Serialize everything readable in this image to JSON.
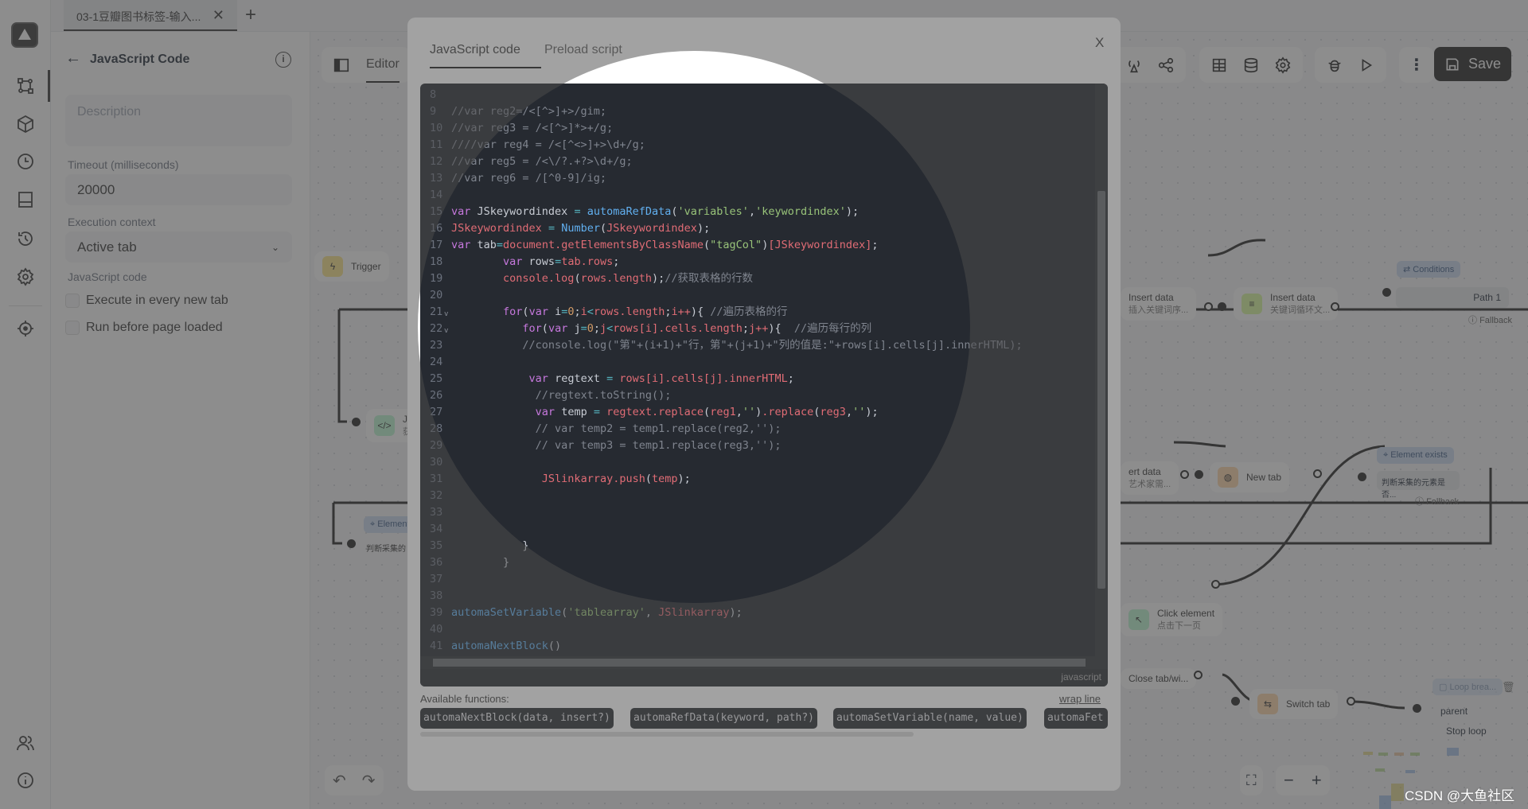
{
  "window_tab": {
    "title": "03-1豆瓣图书标签-输入...",
    "close": "✕",
    "add": "+"
  },
  "rail": {
    "icons": [
      "workflow-icon",
      "package-icon",
      "schedule-icon",
      "storage-icon",
      "history-icon",
      "settings-icon",
      "crosshair-icon",
      "community-icon",
      "about-icon"
    ]
  },
  "panel": {
    "back": "←",
    "title": "JavaScript Code",
    "description_placeholder": "Description",
    "timeout_label": "Timeout (milliseconds)",
    "timeout_value": "20000",
    "context_label": "Execution context",
    "context_value": "Active tab",
    "code_label": "JavaScript code",
    "checkbox_new_tab": "Execute in every new tab",
    "checkbox_before_load": "Run before page loaded"
  },
  "canvas": {
    "editor_tab": "Editor",
    "save_label": "Save",
    "nodes": {
      "trigger": "Trigger",
      "insert1_title": "Insert data",
      "insert1_sub": "插入关键词序...",
      "insert2_title": "Insert data",
      "insert2_sub": "关键词循环文...",
      "conditions": "Conditions",
      "path1": "Path 1",
      "fallback": "Fallback",
      "js_title": "Jav",
      "js_sub": "获取",
      "element_exists": "Element exists",
      "element_short": "Element",
      "element_desc": "判断采集的元素是否...",
      "element_desc_short": "判断采集的",
      "insert3_title": "ert data",
      "insert3_sub": "艺术家需...",
      "newtab": "New tab",
      "click_title": "Click element",
      "click_sub": "点击下一页",
      "closetab": "Close tab/wi...",
      "switchtab": "Switch tab",
      "loopbreak": "Loop brea...",
      "parent": "parent",
      "stoploop": "Stop loop"
    }
  },
  "modal": {
    "tabs": [
      {
        "label": "JavaScript code",
        "active": true
      },
      {
        "label": "Preload script",
        "active": false
      }
    ],
    "close": "X",
    "language": "javascript",
    "available_label": "Available functions:",
    "wrap_label": "wrap line",
    "functions": [
      "automaNextBlock(data, insert?)",
      "automaRefData(keyword, path?)",
      "automaSetVariable(name, value)",
      "automaFet"
    ],
    "code_lines": [
      {
        "n": "8",
        "t": []
      },
      {
        "n": "9",
        "t": [
          [
            "c",
            "//var reg2=/<[^>]+>/gim;"
          ]
        ]
      },
      {
        "n": "10",
        "t": [
          [
            "c",
            "//var reg3 = /<[^>]*>+/g;"
          ]
        ]
      },
      {
        "n": "11",
        "t": [
          [
            "c",
            "////var reg4 = /<[^<>]+>\\d+/g;"
          ]
        ]
      },
      {
        "n": "12",
        "t": [
          [
            "c",
            "//var reg5 = /<\\/?.+?>\\d+/g;"
          ]
        ]
      },
      {
        "n": "13",
        "t": [
          [
            "c",
            "//var reg6 = /[^0-9]/ig;"
          ]
        ]
      },
      {
        "n": "14",
        "t": []
      },
      {
        "n": "15",
        "t": [
          [
            "k",
            "var"
          ],
          [
            "p",
            " JSkeywordindex "
          ],
          [
            "o",
            "="
          ],
          [
            "p",
            " "
          ],
          [
            "f",
            "automaRefData"
          ],
          [
            "p",
            "("
          ],
          [
            "s",
            "'variables'"
          ],
          [
            "p",
            ","
          ],
          [
            "s",
            "'keywordindex'"
          ],
          [
            "p",
            ");"
          ]
        ]
      },
      {
        "n": "16",
        "t": [
          [
            "v",
            "JSkeywordindex"
          ],
          [
            "p",
            " "
          ],
          [
            "o",
            "="
          ],
          [
            "p",
            " "
          ],
          [
            "f",
            "Number"
          ],
          [
            "p",
            "("
          ],
          [
            "v",
            "JSkeywordindex"
          ],
          [
            "p",
            ");"
          ]
        ]
      },
      {
        "n": "17",
        "t": [
          [
            "k",
            "var"
          ],
          [
            "p",
            " tab"
          ],
          [
            "o",
            "="
          ],
          [
            "v",
            "document.getElementsByClassName"
          ],
          [
            "p",
            "("
          ],
          [
            "s",
            "\"tagCol\""
          ],
          [
            "p",
            ")"
          ],
          [
            "v",
            "[JSkeywordindex]"
          ],
          [
            "p",
            ";"
          ]
        ]
      },
      {
        "n": "18",
        "t": [
          [
            "p",
            "        "
          ],
          [
            "k",
            "var"
          ],
          [
            "p",
            " rows"
          ],
          [
            "o",
            "="
          ],
          [
            "v",
            "tab.rows"
          ],
          [
            "p",
            ";"
          ]
        ]
      },
      {
        "n": "19",
        "t": [
          [
            "p",
            "        "
          ],
          [
            "v",
            "console.log"
          ],
          [
            "p",
            "("
          ],
          [
            "v",
            "rows.length"
          ],
          [
            "p",
            ");"
          ],
          [
            "c",
            "//获取表格的行数"
          ]
        ]
      },
      {
        "n": "20",
        "t": []
      },
      {
        "n": "21",
        "fold": true,
        "t": [
          [
            "p",
            "        "
          ],
          [
            "k",
            "for"
          ],
          [
            "p",
            "("
          ],
          [
            "k",
            "var"
          ],
          [
            "p",
            " i"
          ],
          [
            "o",
            "="
          ],
          [
            "n",
            "0"
          ],
          [
            "p",
            ";"
          ],
          [
            "v",
            "i"
          ],
          [
            "o",
            "<"
          ],
          [
            "v",
            "rows.length"
          ],
          [
            "p",
            ";"
          ],
          [
            "v",
            "i++"
          ],
          [
            "p",
            "){ "
          ],
          [
            "c",
            "//遍历表格的行"
          ]
        ]
      },
      {
        "n": "22",
        "fold": true,
        "t": [
          [
            "p",
            "           "
          ],
          [
            "k",
            "for"
          ],
          [
            "p",
            "("
          ],
          [
            "k",
            "var"
          ],
          [
            "p",
            " j"
          ],
          [
            "o",
            "="
          ],
          [
            "n",
            "0"
          ],
          [
            "p",
            ";"
          ],
          [
            "v",
            "j"
          ],
          [
            "o",
            "<"
          ],
          [
            "v",
            "rows[i].cells.length"
          ],
          [
            "p",
            ";"
          ],
          [
            "v",
            "j++"
          ],
          [
            "p",
            "){  "
          ],
          [
            "c",
            "//遍历每行的列"
          ]
        ]
      },
      {
        "n": "23",
        "t": [
          [
            "p",
            "           "
          ],
          [
            "c",
            "//console.log(\"第\"+(i+1)+\"行，第\"+(j+1)+\"列的值是:\"+rows[i].cells[j].innerHTML);"
          ]
        ]
      },
      {
        "n": "24",
        "t": []
      },
      {
        "n": "25",
        "t": [
          [
            "p",
            "            "
          ],
          [
            "k",
            "var"
          ],
          [
            "p",
            " regtext "
          ],
          [
            "o",
            "="
          ],
          [
            "p",
            " "
          ],
          [
            "v",
            "rows[i].cells[j].innerHTML"
          ],
          [
            "p",
            ";"
          ]
        ]
      },
      {
        "n": "26",
        "t": [
          [
            "p",
            "             "
          ],
          [
            "c",
            "//regtext.toString();"
          ]
        ]
      },
      {
        "n": "27",
        "t": [
          [
            "p",
            "             "
          ],
          [
            "k",
            "var"
          ],
          [
            "p",
            " temp "
          ],
          [
            "o",
            "="
          ],
          [
            "p",
            " "
          ],
          [
            "v",
            "regtext.replace"
          ],
          [
            "p",
            "("
          ],
          [
            "v",
            "reg1"
          ],
          [
            "p",
            ","
          ],
          [
            "s",
            "''"
          ],
          [
            "p",
            ")"
          ],
          [
            "v",
            ".replace"
          ],
          [
            "p",
            "("
          ],
          [
            "v",
            "reg3"
          ],
          [
            "p",
            ","
          ],
          [
            "s",
            "''"
          ],
          [
            "p",
            ");"
          ]
        ]
      },
      {
        "n": "28",
        "t": [
          [
            "p",
            "             "
          ],
          [
            "c",
            "// var temp2 = temp1.replace(reg2,'');"
          ]
        ]
      },
      {
        "n": "29",
        "t": [
          [
            "p",
            "             "
          ],
          [
            "c",
            "// var temp3 = temp1.replace(reg3,'');"
          ]
        ]
      },
      {
        "n": "30",
        "t": []
      },
      {
        "n": "31",
        "t": [
          [
            "p",
            "              "
          ],
          [
            "v",
            "JSlinkarray.push"
          ],
          [
            "p",
            "("
          ],
          [
            "v",
            "temp"
          ],
          [
            "p",
            ");"
          ]
        ]
      },
      {
        "n": "32",
        "t": []
      },
      {
        "n": "33",
        "t": []
      },
      {
        "n": "34",
        "t": []
      },
      {
        "n": "35",
        "t": [
          [
            "p",
            "           }"
          ]
        ]
      },
      {
        "n": "36",
        "t": [
          [
            "p",
            "        }"
          ]
        ]
      },
      {
        "n": "37",
        "t": []
      },
      {
        "n": "38",
        "t": []
      },
      {
        "n": "39",
        "t": [
          [
            "f",
            "automaSetVariable"
          ],
          [
            "p",
            "("
          ],
          [
            "s",
            "'tablearray'"
          ],
          [
            "p",
            ", "
          ],
          [
            "v",
            "JSlinkarray"
          ],
          [
            "p",
            ");"
          ]
        ]
      },
      {
        "n": "40",
        "t": []
      },
      {
        "n": "41",
        "t": [
          [
            "f",
            "automaNextBlock"
          ],
          [
            "p",
            "()"
          ]
        ]
      }
    ]
  },
  "watermark": "CSDN @大鱼社区",
  "colors": {
    "accent": "#222222",
    "code_bg": "#262a31",
    "keyword": "#c678dd",
    "string": "#98c379",
    "function": "#61afef",
    "variable": "#e06c75"
  }
}
